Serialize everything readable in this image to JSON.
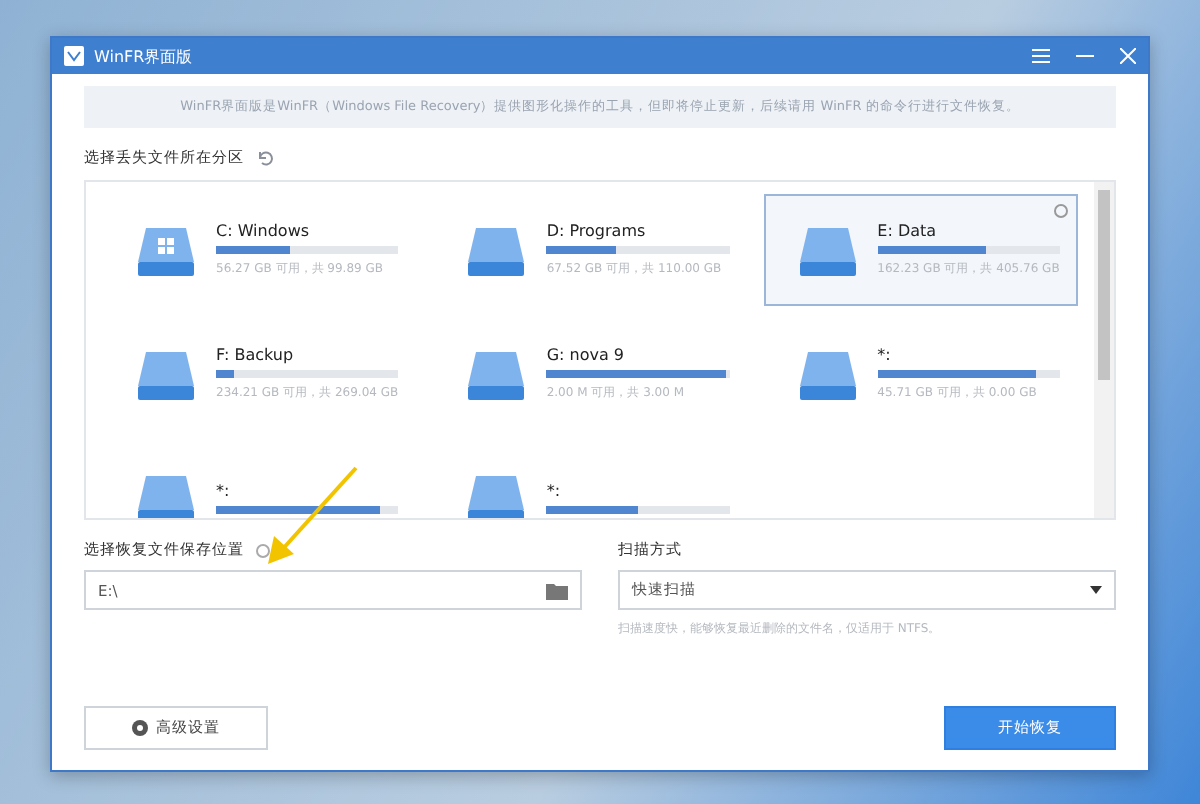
{
  "window": {
    "title": "WinFR界面版"
  },
  "notice": "WinFR界面版是WinFR（Windows File Recovery）提供图形化操作的工具，但即将停止更新，后续请用 WinFR 的命令行进行文件恢复。",
  "partition_section": {
    "label": "选择丢失文件所在分区"
  },
  "partitions": [
    {
      "name": "C: Windows",
      "stats": "56.27 GB 可用，共 99.89 GB",
      "level": 0.4,
      "selected": false,
      "kind": "system"
    },
    {
      "name": "D: Programs",
      "stats": "67.52 GB 可用，共 110.00 GB",
      "level": 0.38,
      "selected": false,
      "kind": "disk"
    },
    {
      "name": "E: Data",
      "stats": "162.23 GB 可用，共 405.76 GB",
      "level": 0.6,
      "selected": true,
      "kind": "disk"
    },
    {
      "name": "F: Backup",
      "stats": "234.21 GB 可用，共 269.04 GB",
      "level": 0.1,
      "selected": false,
      "kind": "disk"
    },
    {
      "name": "G: nova 9",
      "stats": "2.00 M 可用，共 3.00 M",
      "level": 0.98,
      "selected": false,
      "kind": "disk"
    },
    {
      "name": "*:",
      "stats": "45.71 GB 可用，共 0.00 GB",
      "level": 0.87,
      "selected": false,
      "kind": "disk"
    },
    {
      "name": "*:",
      "level": 0.9,
      "selected": false,
      "kind": "disk"
    },
    {
      "name": "*:",
      "level": 0.5,
      "selected": false,
      "kind": "disk"
    }
  ],
  "save_location": {
    "label": "选择恢复文件保存位置",
    "value": "E:\\"
  },
  "scan_mode": {
    "label": "扫描方式",
    "value": "快速扫描",
    "hint": "扫描速度快，能够恢复最近删除的文件名，仅适用于 NTFS。"
  },
  "buttons": {
    "advanced": "高级设置",
    "start": "开始恢复"
  }
}
